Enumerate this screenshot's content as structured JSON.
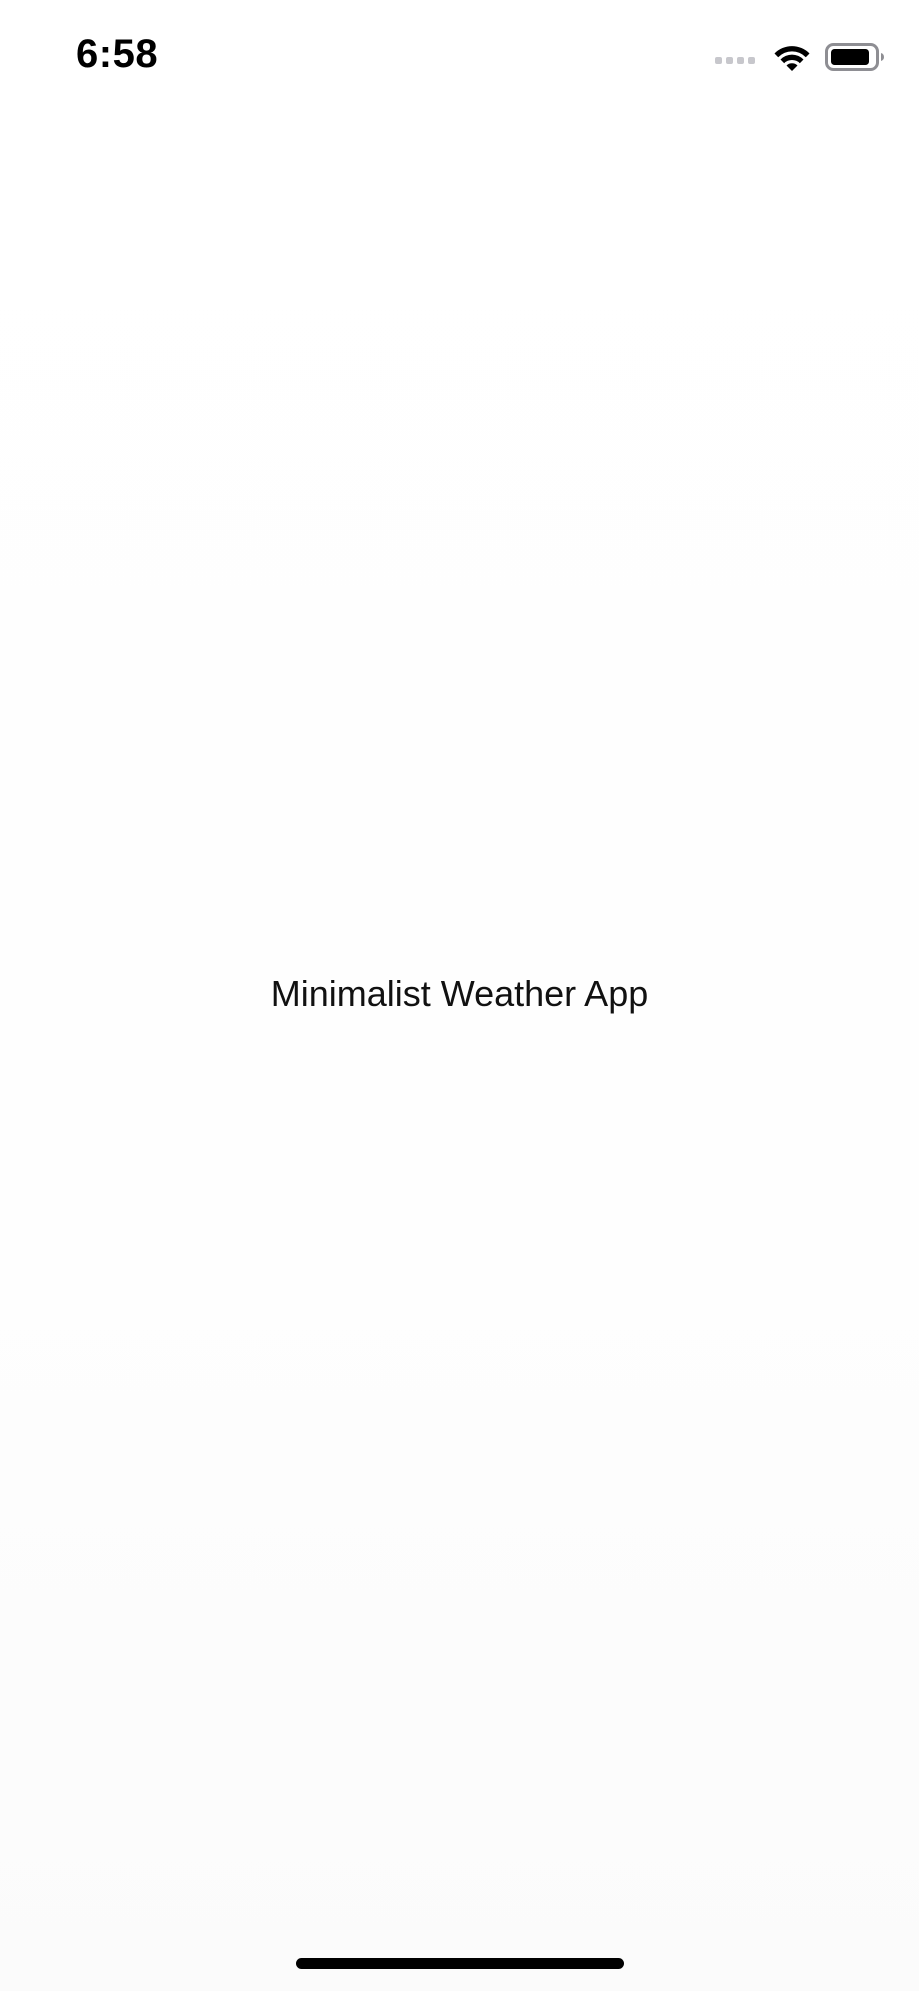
{
  "status_bar": {
    "time": "6:58",
    "signal_icon": "cellular-signal-icon",
    "wifi_icon": "wifi-icon",
    "battery_icon": "battery-icon"
  },
  "main": {
    "title": "Minimalist Weather App"
  },
  "colors": {
    "background": "#ffffff",
    "text": "#111111",
    "inactive_signal": "#c7c7cc"
  }
}
